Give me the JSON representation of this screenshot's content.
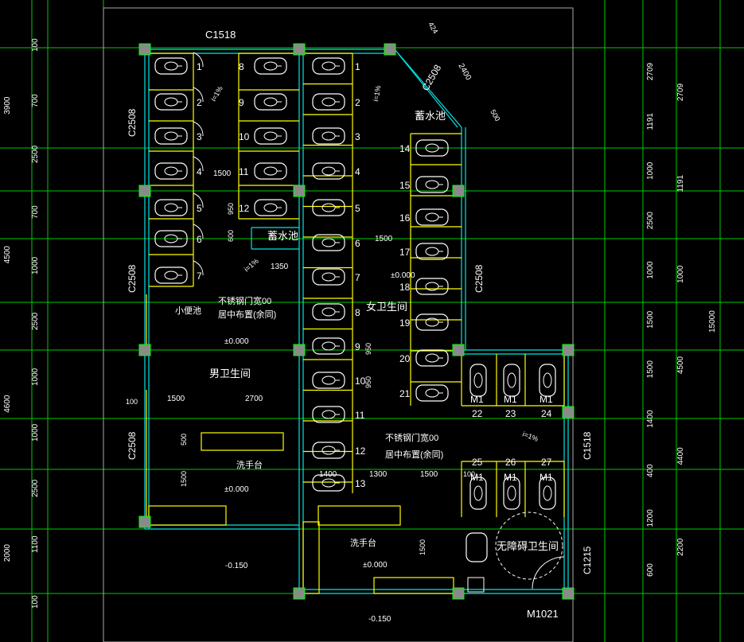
{
  "colors": {
    "background": "#000000",
    "grid": "#00ff00",
    "wall": "#00ffff",
    "partition": "#ffff00",
    "text": "#ffffff",
    "column": "#8a8a8a",
    "dimension": "#00ff00"
  },
  "labels": {
    "window_top": "C1518",
    "window_left_1": "C2508",
    "window_left_2": "C2508",
    "window_left_3": "C2508",
    "window_diag": "C2508",
    "window_mid_right": "C2508",
    "window_right": "C1518",
    "window_bottom_right": "C1215",
    "door_bottom": "M1021",
    "tank_top": "蓄水池",
    "tank_mid": "蓄水池",
    "mens_room": "男卫生间",
    "womens_room": "女卫生间",
    "accessible_room": "无障碍卫生间",
    "urinal": "小便池",
    "sink_men": "洗手台",
    "sink_women": "洗手台",
    "door_note_1a": "不锈钢门宽00",
    "door_note_1b": "居中布置(余同)",
    "door_note_2a": "不锈钢门宽00",
    "door_note_2b": "居中布置(余同)",
    "slope_1": "i=1%",
    "slope_2": "i=1%",
    "slope_3": "i=1%",
    "slope_4": "i=1%",
    "elev_1": "±0.000",
    "elev_2": "±0.000",
    "elev_3": "±0.000",
    "elev_4": "±0.000",
    "elev_5": "-0.150",
    "elev_6": "-0.150",
    "dim_1500_a": "1500",
    "dim_1500_b": "1500",
    "dim_1500_c": "1500",
    "dim_1500_d": "1500",
    "dim_2700": "2700",
    "dim_1350": "1350",
    "dim_1300": "1300",
    "dim_950_a": "950",
    "dim_950_b": "950",
    "dim_950_c": "950",
    "dim_600": "600",
    "dim_100_a": "100",
    "dim_100_b": "100",
    "dim_500": "500",
    "dim_1500_v": "1500",
    "dim_1500_v2": "1500",
    "dim_1400": "1400",
    "dim_2400": "2400",
    "dim_424": "424",
    "dim_500_d": "500",
    "m1": "M1"
  },
  "left_dims_outer": [
    "3900",
    "4500",
    "4600",
    "2000"
  ],
  "left_dims_inner": [
    "100",
    "700",
    "2500",
    "700",
    "1000",
    "2500",
    "1000",
    "1000",
    "2500",
    "1100",
    "100"
  ],
  "right_dims_inner": [
    "2709",
    "1191",
    "1000",
    "2500",
    "1000",
    "1500",
    "1500",
    "1400",
    "400",
    "1200",
    "600"
  ],
  "right_dims_mid": [
    "2709",
    "1191",
    "1000",
    "4500",
    "4400",
    "2200"
  ],
  "right_dims_total": "15000",
  "stall_numbers": [
    "1",
    "2",
    "3",
    "4",
    "5",
    "6",
    "7",
    "8",
    "9",
    "10",
    "11",
    "12",
    "13",
    "14",
    "15",
    "16",
    "17",
    "18",
    "19",
    "20",
    "21",
    "22",
    "23",
    "24",
    "25",
    "26",
    "27"
  ]
}
